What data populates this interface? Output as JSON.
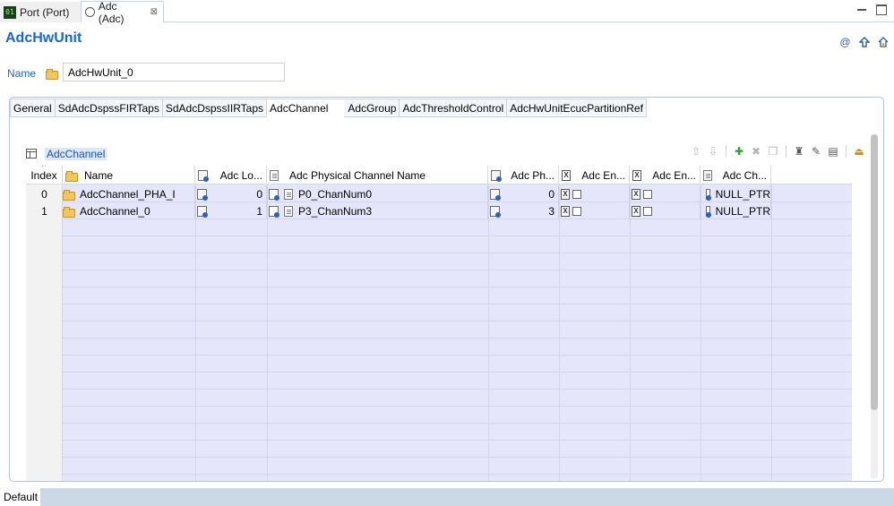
{
  "editor_tabs": [
    {
      "label": "Port (Port)",
      "icon": "port-module-icon",
      "active": false
    },
    {
      "label": "Adc (Adc)",
      "icon": "adc-module-icon",
      "active": true,
      "close": "⊠"
    }
  ],
  "header": {
    "title": "AdcHwUnit",
    "icons": [
      "at-icon",
      "up-arrow-icon",
      "home-icon"
    ]
  },
  "name_field": {
    "label": "Name",
    "value": "AdcHwUnit_0"
  },
  "form_tabs": [
    "General",
    "SdAdcDspssFIRTaps",
    "SdAdcDspssIIRTaps",
    "AdcChannel",
    "AdcGroup",
    "AdcThresholdControl",
    "AdcHwUnitEcucPartitionRef"
  ],
  "active_form_tab": "AdcChannel",
  "table": {
    "title": "AdcChannel",
    "toolbar": [
      "move-up-icon",
      "move-down-icon",
      "add-icon",
      "delete-icon",
      "copy-icon",
      "stamp-icon",
      "edit-icon",
      "edit-table-icon",
      "export-icon"
    ],
    "columns": [
      {
        "label": "Index"
      },
      {
        "label": "Name"
      },
      {
        "label": "Adc Lo..."
      },
      {
        "label": "Adc Physical Channel Name"
      },
      {
        "label": "Adc Ph..."
      },
      {
        "label": "Adc En..."
      },
      {
        "label": "Adc En..."
      },
      {
        "label": "Adc Ch..."
      }
    ],
    "rows": [
      {
        "index": "0",
        "name": "AdcChannel_PHA_I",
        "logical": "0",
        "physical_name": "P0_ChanNum0",
        "physical": "0",
        "en1": false,
        "en2": false,
        "ch": "NULL_PTR"
      },
      {
        "index": "1",
        "name": "AdcChannel_0",
        "logical": "1",
        "physical_name": "P3_ChanNum3",
        "physical": "3",
        "en1": false,
        "en2": false,
        "ch": "NULL_PTR"
      }
    ]
  },
  "status": {
    "label": "Default"
  },
  "colors": {
    "title_blue": "#1a66cc",
    "grid_bg": "#e6e6fa",
    "status_fill": "#ccd8e8"
  }
}
